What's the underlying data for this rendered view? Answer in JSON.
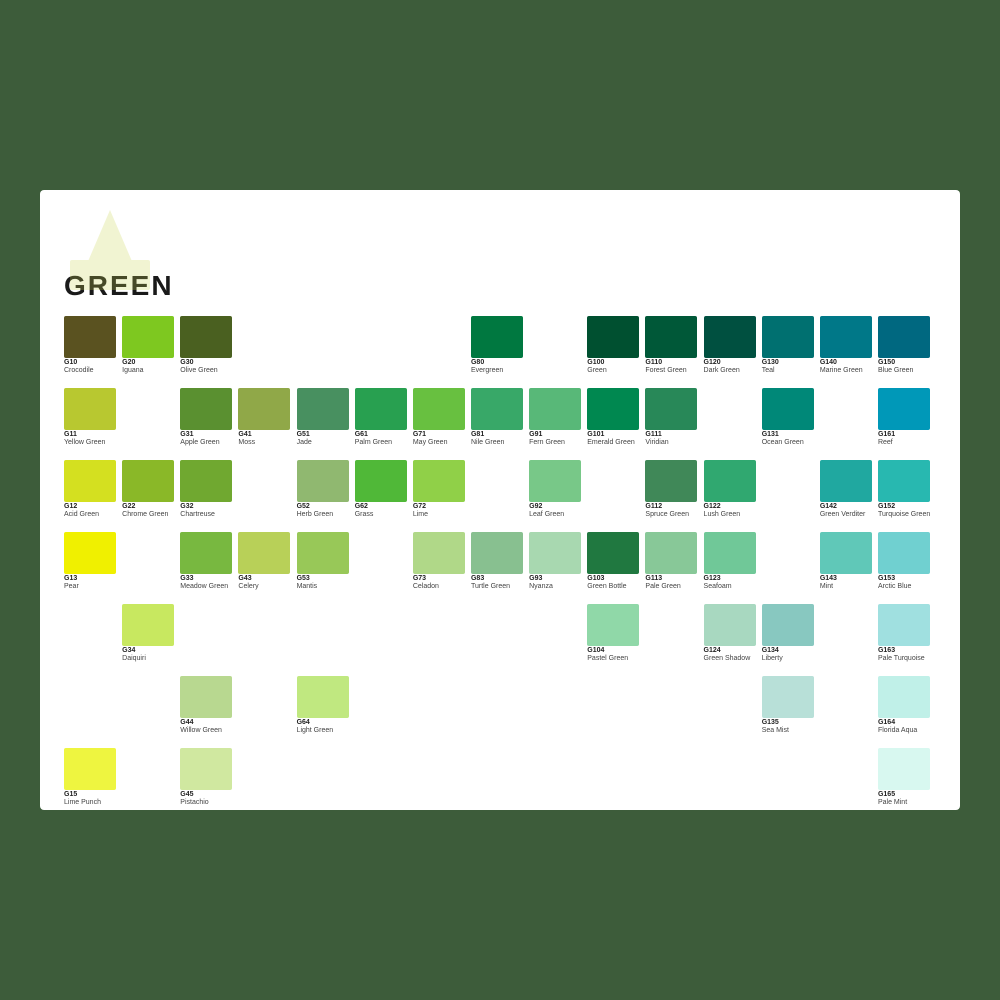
{
  "title": "GREEN",
  "columns": [
    {
      "id": "col1",
      "swatches": [
        {
          "code": "G10",
          "name": "Crocodile",
          "color": "#5a5220",
          "row": 0
        },
        {
          "code": "G11",
          "name": "Yellow Green",
          "color": "#b8c830",
          "row": 1
        },
        {
          "code": "G12",
          "name": "Acid Green",
          "color": "#d4e020",
          "row": 2
        },
        {
          "code": "G13",
          "name": "Pear",
          "color": "#f0f000",
          "row": 3
        },
        null,
        null,
        {
          "code": "G15",
          "name": "Lime Punch",
          "color": "#eef540",
          "row": 6
        }
      ]
    },
    {
      "id": "col2",
      "swatches": [
        {
          "code": "G20",
          "name": "Iguana",
          "color": "#7ec820",
          "row": 0
        },
        null,
        {
          "code": "G22",
          "name": "Chrome Green",
          "color": "#8ab828",
          "row": 2
        },
        null,
        {
          "code": "G34",
          "name": "Daiquiri",
          "color": "#c8e860",
          "row": 4
        },
        null,
        null
      ]
    },
    {
      "id": "col3",
      "swatches": [
        {
          "code": "G30",
          "name": "Olive Green",
          "color": "#4a6020",
          "row": 0
        },
        {
          "code": "G31",
          "name": "Apple Green",
          "color": "#5a9030",
          "row": 1
        },
        {
          "code": "G32",
          "name": "Chartreuse",
          "color": "#70a830",
          "row": 2
        },
        {
          "code": "G33",
          "name": "Meadow Green",
          "color": "#78b840",
          "row": 3
        },
        null,
        {
          "code": "G44",
          "name": "Willow Green",
          "color": "#b8d890",
          "row": 5
        },
        {
          "code": "G45",
          "name": "Pistachio",
          "color": "#d0e8a0",
          "row": 6
        }
      ]
    },
    {
      "id": "col4",
      "swatches": [
        null,
        {
          "code": "G41",
          "name": "Moss",
          "color": "#90a848",
          "row": 1
        },
        null,
        {
          "code": "G43",
          "name": "Celery",
          "color": "#b8d058",
          "row": 3
        },
        null,
        null,
        null
      ]
    },
    {
      "id": "col5",
      "swatches": [
        null,
        {
          "code": "G51",
          "name": "Jade",
          "color": "#489060",
          "row": 1
        },
        {
          "code": "G52",
          "name": "Herb Green",
          "color": "#90b870",
          "row": 2
        },
        {
          "code": "G53",
          "name": "Mantis",
          "color": "#98c858",
          "row": 3
        },
        null,
        {
          "code": "G64",
          "name": "Light Green",
          "color": "#c0e880",
          "row": 5
        },
        null
      ]
    },
    {
      "id": "col6",
      "swatches": [
        null,
        {
          "code": "G61",
          "name": "Palm Green",
          "color": "#28a050",
          "row": 1
        },
        {
          "code": "G62",
          "name": "Grass",
          "color": "#50b838",
          "row": 2
        },
        null,
        null,
        null,
        null
      ]
    },
    {
      "id": "col7",
      "swatches": [
        null,
        {
          "code": "G71",
          "name": "May Green",
          "color": "#68c040",
          "row": 1
        },
        {
          "code": "G72",
          "name": "Lime",
          "color": "#90d048",
          "row": 2
        },
        {
          "code": "G73",
          "name": "Celadon",
          "color": "#b0d888",
          "row": 3
        },
        null,
        null,
        null
      ]
    },
    {
      "id": "col8",
      "swatches": [
        {
          "code": "G80",
          "name": "Evergreen",
          "color": "#007840",
          "row": 0
        },
        {
          "code": "G81",
          "name": "Nile Green",
          "color": "#38a868",
          "row": 1
        },
        null,
        {
          "code": "G83",
          "name": "Turtle Green",
          "color": "#88c090",
          "row": 3
        },
        null,
        null,
        null
      ]
    },
    {
      "id": "col9",
      "swatches": [
        null,
        {
          "code": "G91",
          "name": "Fern Green",
          "color": "#58b878",
          "row": 1
        },
        {
          "code": "G92",
          "name": "Leaf Green",
          "color": "#78c888",
          "row": 2
        },
        {
          "code": "G93",
          "name": "Nyanza",
          "color": "#a8d8b0",
          "row": 3
        },
        null,
        null,
        null
      ]
    },
    {
      "id": "col10",
      "swatches": [
        {
          "code": "G100",
          "name": "Green",
          "color": "#005030",
          "row": 0
        },
        {
          "code": "G101",
          "name": "Emerald Green",
          "color": "#008850",
          "row": 1
        },
        null,
        {
          "code": "G103",
          "name": "Green Bottle",
          "color": "#207840",
          "row": 3
        },
        {
          "code": "G104",
          "name": "Pastel Green",
          "color": "#90d8a8",
          "row": 4
        },
        null,
        null
      ]
    },
    {
      "id": "col11",
      "swatches": [
        {
          "code": "G110",
          "name": "Forest Green",
          "color": "#005838",
          "row": 0
        },
        {
          "code": "G111",
          "name": "Viridian",
          "color": "#288858",
          "row": 1
        },
        {
          "code": "G112",
          "name": "Spruce Green",
          "color": "#408858",
          "row": 2
        },
        {
          "code": "G113",
          "name": "Pale Green",
          "color": "#88c898",
          "row": 3
        },
        null,
        null,
        null
      ]
    },
    {
      "id": "col12",
      "swatches": [
        {
          "code": "G120",
          "name": "Dark Green",
          "color": "#005040",
          "row": 0
        },
        null,
        {
          "code": "G122",
          "name": "Lush Green",
          "color": "#30a870",
          "row": 2
        },
        {
          "code": "G123",
          "name": "Seafoam",
          "color": "#70c898",
          "row": 3
        },
        {
          "code": "G124",
          "name": "Green Shadow",
          "color": "#a8d8c0",
          "row": 4
        },
        null,
        null
      ]
    },
    {
      "id": "col13",
      "swatches": [
        {
          "code": "G130",
          "name": "Teal",
          "color": "#007070",
          "row": 0
        },
        {
          "code": "G131",
          "name": "Ocean Green",
          "color": "#008878",
          "row": 1
        },
        null,
        null,
        {
          "code": "G134",
          "name": "Liberty",
          "color": "#88c8c0",
          "row": 4
        },
        {
          "code": "G135",
          "name": "Sea Mist",
          "color": "#b8e0d8",
          "row": 5
        },
        null
      ]
    },
    {
      "id": "col14",
      "swatches": [
        {
          "code": "G140",
          "name": "Marine Green",
          "color": "#007888",
          "row": 0
        },
        null,
        {
          "code": "G142",
          "name": "Green Verditer",
          "color": "#20a8a0",
          "row": 2
        },
        {
          "code": "G143",
          "name": "Mint",
          "color": "#60c8b8",
          "row": 3
        },
        null,
        null,
        null
      ]
    },
    {
      "id": "col15",
      "swatches": [
        {
          "code": "G150",
          "name": "Blue Green",
          "color": "#006880",
          "row": 0
        },
        {
          "code": "G161",
          "name": "Reef",
          "color": "#0098b8",
          "row": 1
        },
        {
          "code": "G152",
          "name": "Turquoise Green",
          "color": "#28b8b0",
          "row": 2
        },
        {
          "code": "G153",
          "name": "Arctic Blue",
          "color": "#70d0d0",
          "row": 3
        },
        {
          "code": "G163",
          "name": "Pale Turquoise",
          "color": "#a0e0e0",
          "row": 4
        },
        {
          "code": "G164",
          "name": "Florida Aqua",
          "color": "#c0f0e8",
          "row": 5
        },
        {
          "code": "G165",
          "name": "Pale Mint",
          "color": "#d8f8f0",
          "row": 6
        }
      ]
    }
  ]
}
